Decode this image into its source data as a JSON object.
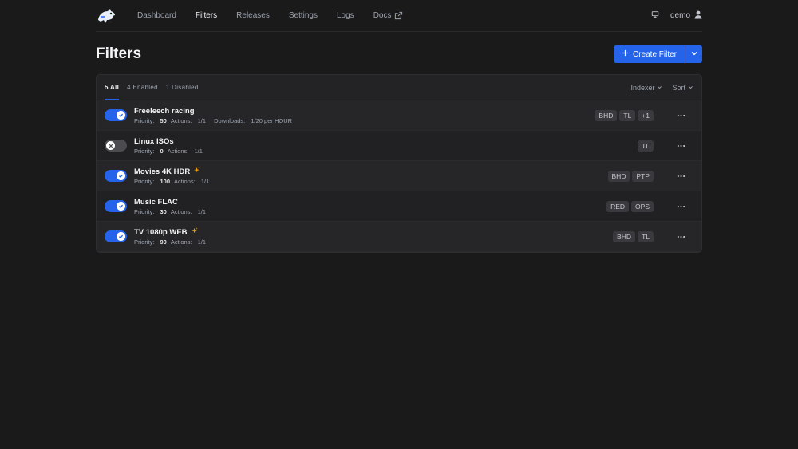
{
  "nav": {
    "links": [
      "Dashboard",
      "Filters",
      "Releases",
      "Settings",
      "Logs",
      "Docs"
    ],
    "user": "demo"
  },
  "header": {
    "title": "Filters",
    "create_label": "Create Filter"
  },
  "tabs": [
    "5 All",
    "4 Enabled",
    "1 Disabled"
  ],
  "dropdowns": {
    "indexer": "Indexer",
    "sort": "Sort"
  },
  "labels": {
    "priority": "Priority:",
    "actions": "Actions:",
    "downloads": "Downloads:"
  },
  "filters": [
    {
      "name": "Freeleech racing",
      "enabled": true,
      "priority": "50",
      "actions": "1/1",
      "downloads": "1/20 per HOUR",
      "tags": [
        "BHD",
        "TL",
        "+1"
      ],
      "sparkle": false
    },
    {
      "name": "Linux ISOs",
      "enabled": false,
      "priority": "0",
      "actions": "1/1",
      "downloads": "",
      "tags": [
        "TL"
      ],
      "sparkle": false
    },
    {
      "name": "Movies 4K HDR",
      "enabled": true,
      "priority": "100",
      "actions": "1/1",
      "downloads": "",
      "tags": [
        "BHD",
        "PTP"
      ],
      "sparkle": true
    },
    {
      "name": "Music FLAC",
      "enabled": true,
      "priority": "30",
      "actions": "1/1",
      "downloads": "",
      "tags": [
        "RED",
        "OPS"
      ],
      "sparkle": false
    },
    {
      "name": "TV 1080p WEB",
      "enabled": true,
      "priority": "90",
      "actions": "1/1",
      "downloads": "",
      "tags": [
        "BHD",
        "TL"
      ],
      "sparkle": true
    }
  ],
  "colors": {
    "accent": "#2563eb",
    "background": "#1a1a1b",
    "sparkle": "#f59e0b"
  }
}
